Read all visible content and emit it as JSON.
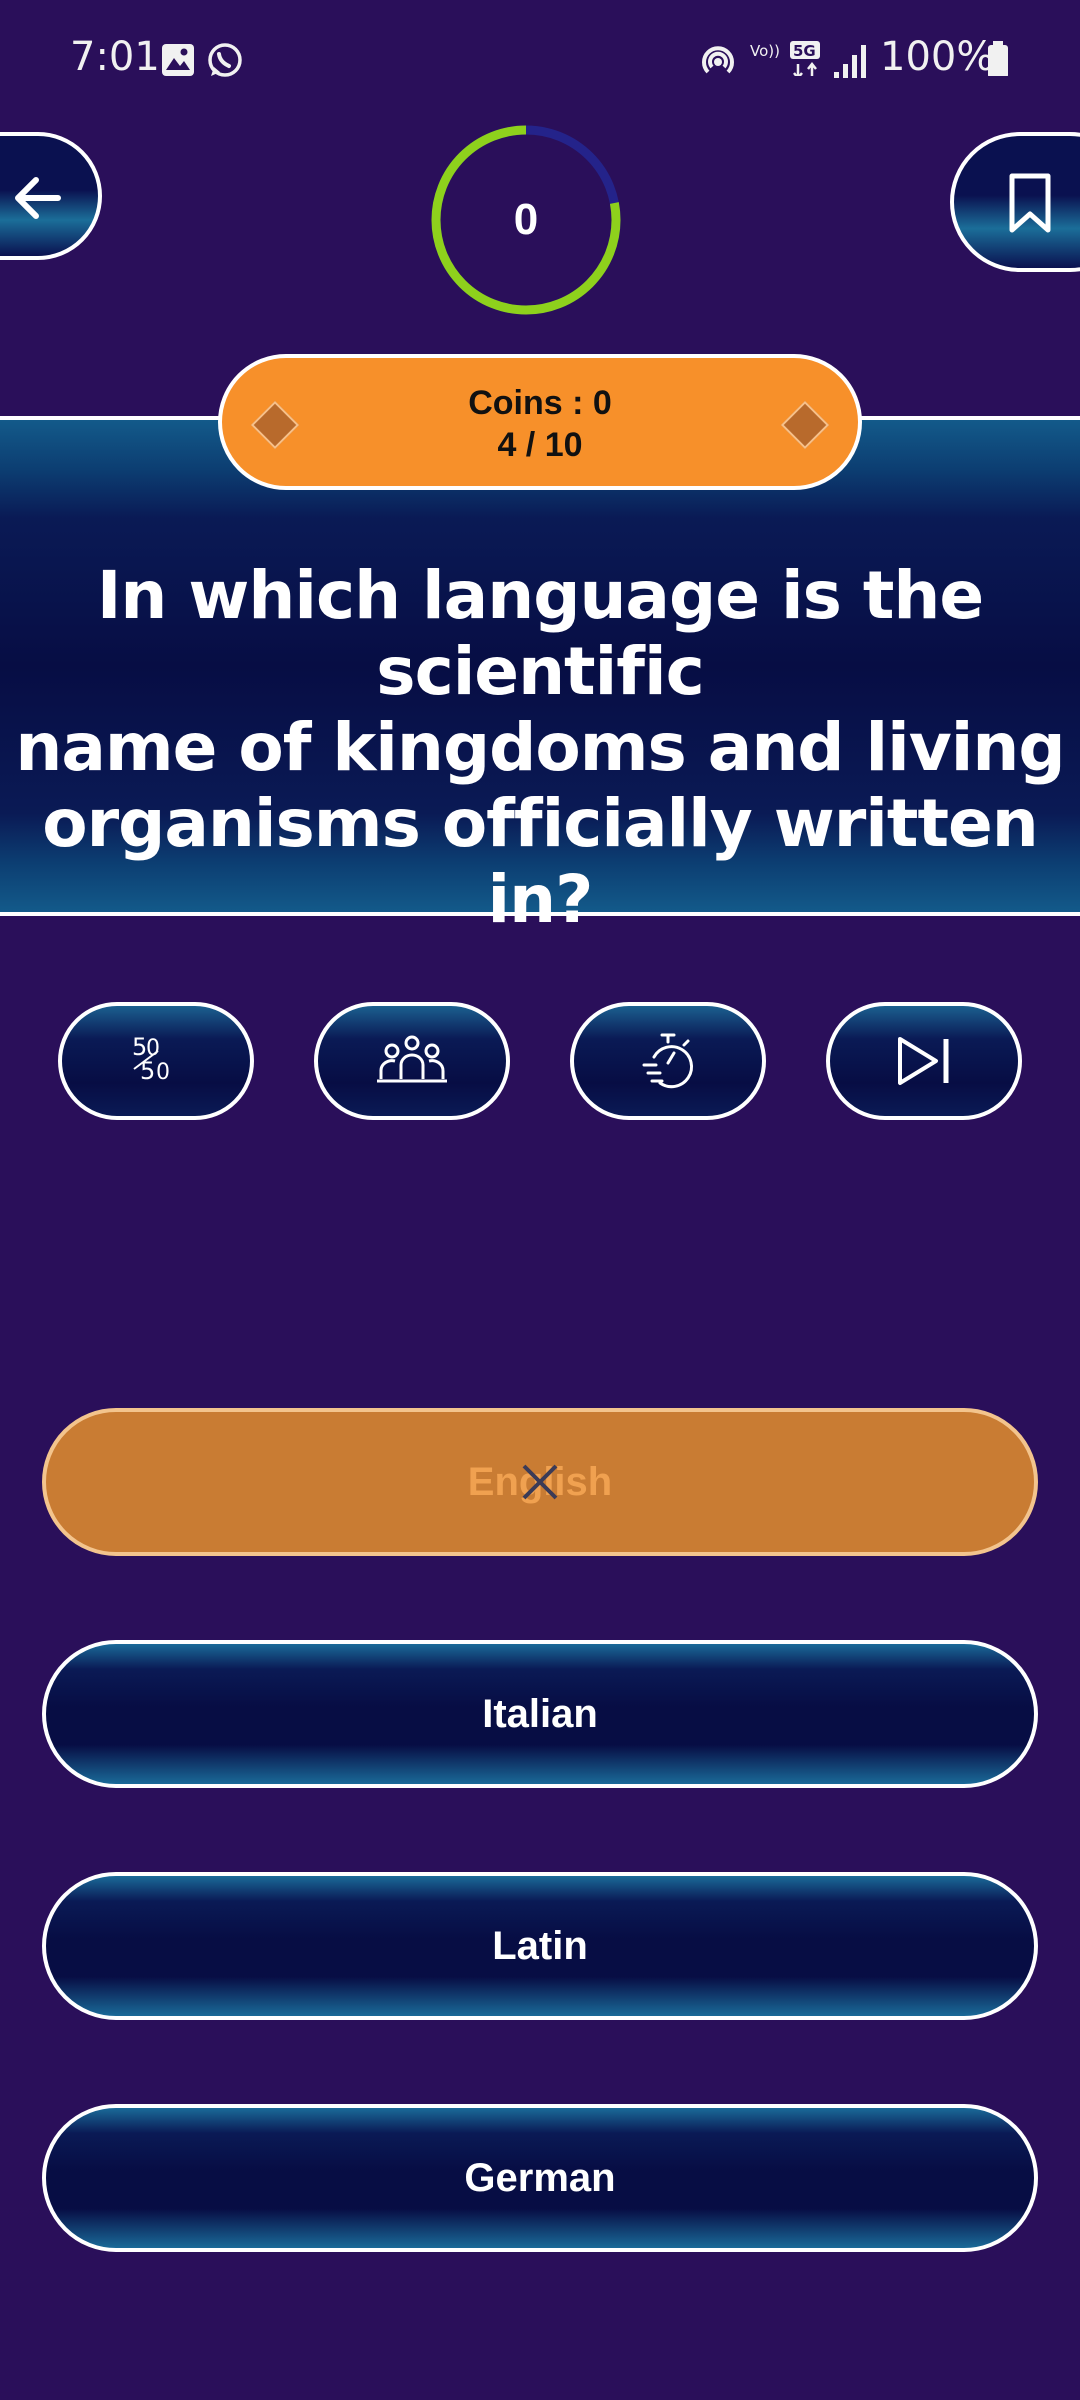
{
  "status_bar": {
    "time": "7:01",
    "battery": "100%",
    "network_labels": [
      "Vo)) 5G",
      "5G"
    ]
  },
  "header": {
    "timer_value": "0",
    "timer_progress": 0.78,
    "coins_label": "Coins : 0",
    "progress_label": "4 / 10"
  },
  "question": {
    "lines": [
      "In which language is the scientific",
      "name of kingdoms and living",
      "organisms officially written in?"
    ]
  },
  "lifelines": [
    {
      "name": "fifty-fifty",
      "icon": "fifty-fifty-icon"
    },
    {
      "name": "audience-poll",
      "icon": "audience-icon"
    },
    {
      "name": "time-freeze",
      "icon": "stopwatch-icon"
    },
    {
      "name": "skip-question",
      "icon": "skip-icon"
    }
  ],
  "answers": [
    {
      "label": "English",
      "state": "wrong"
    },
    {
      "label": "Italian",
      "state": "default"
    },
    {
      "label": "Latin",
      "state": "default"
    },
    {
      "label": "German",
      "state": "default"
    }
  ],
  "colors": {
    "background": "#2a0f5a",
    "accent_orange": "#f7902a",
    "wrong_answer": "#c97c33",
    "timer_ring": "#8ed11c",
    "timer_track": "#24238a"
  }
}
